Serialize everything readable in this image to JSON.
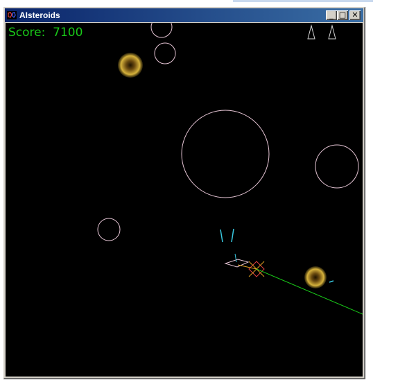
{
  "window": {
    "title": "AIsteroids",
    "minimize_symbol": "_",
    "maximize_symbol": "□",
    "close_symbol": "✕"
  },
  "hud": {
    "score_label": "Score:",
    "score_value": "7100",
    "lives_remaining": 2
  },
  "colors": {
    "score_text": "#19c919",
    "asteroid_outline": "#e7c6d6",
    "ship_projectile": "#38c8e0",
    "laser": "#19c919",
    "powerup_glow": "#e0c040",
    "background": "#000000"
  },
  "icons": [
    "app-icon",
    "minimize-icon",
    "maximize-icon",
    "close-icon",
    "life-ship-icon",
    "player-ship-icon",
    "powerup-icon"
  ]
}
